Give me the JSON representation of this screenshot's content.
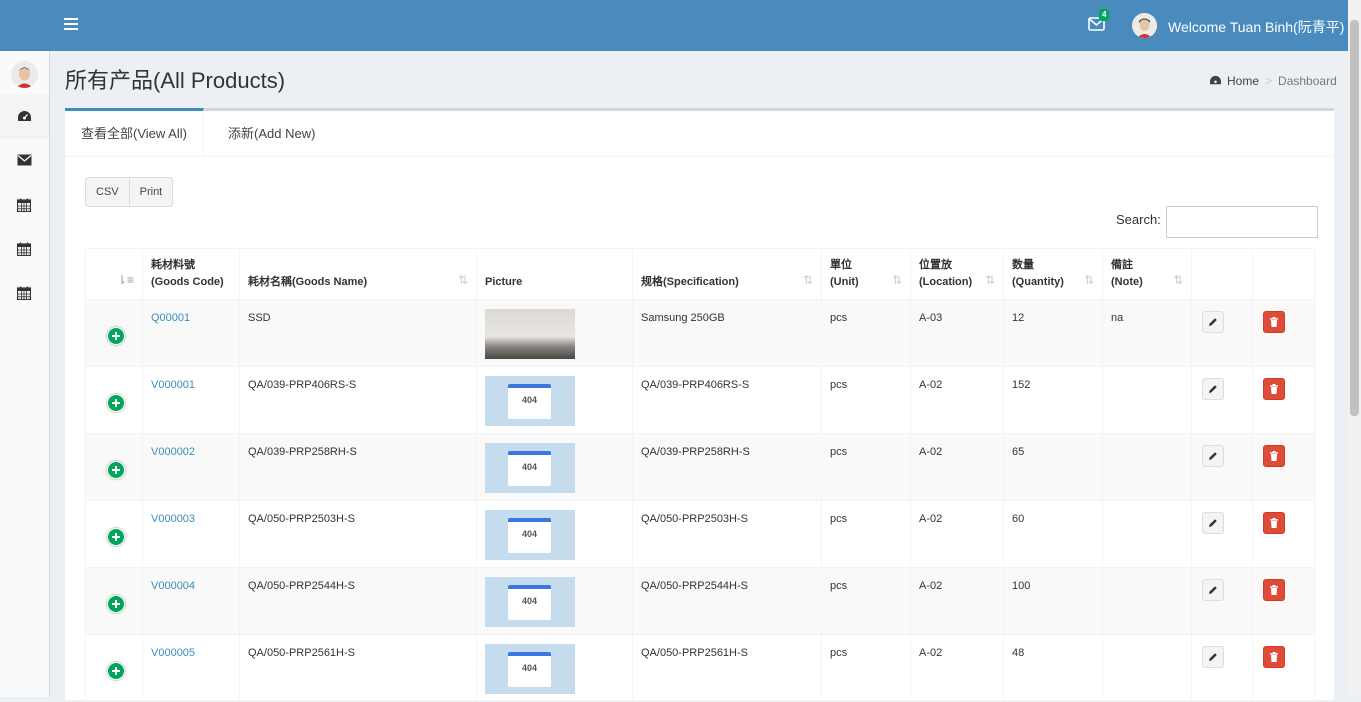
{
  "header": {
    "welcome": "Welcome Tuan Binh(阮青平)",
    "mail_count": "4",
    "menu_icon": "hamburger-icon",
    "mail_icon": "envelope-icon"
  },
  "sidebar": {
    "items": [
      {
        "icon": "dashboard-icon"
      },
      {
        "icon": "envelope-icon"
      },
      {
        "icon": "calendar-icon"
      },
      {
        "icon": "calendar-icon"
      },
      {
        "icon": "calendar-icon"
      }
    ]
  },
  "page": {
    "title": "所有产品(All Products)",
    "breadcrumb_home": "Home",
    "breadcrumb_current": "Dashboard"
  },
  "tabs": [
    {
      "label": "查看全部(View All)",
      "active": true
    },
    {
      "label": "添新(Add New)",
      "active": false
    }
  ],
  "toolbar": {
    "csv": "CSV",
    "print": "Print",
    "search_label": "Search:",
    "search_value": ""
  },
  "table": {
    "columns": [
      {
        "line1": "",
        "line2": ""
      },
      {
        "line1": "耗材料號",
        "line2": "(Goods Code)"
      },
      {
        "line1": "",
        "line2": "耗材名稱(Goods Name)"
      },
      {
        "line1": "",
        "line2": "Picture"
      },
      {
        "line1": "",
        "line2": "规格(Specification)"
      },
      {
        "line1": "單位",
        "line2": "(Unit)"
      },
      {
        "line1": "位置放",
        "line2": "(Location)"
      },
      {
        "line1": "数量",
        "line2": "(Quantity)"
      },
      {
        "line1": "備註",
        "line2": "(Note)"
      },
      {
        "line1": "",
        "line2": ""
      },
      {
        "line1": "",
        "line2": ""
      }
    ],
    "rows": [
      {
        "code": "Q00001",
        "name": "SSD",
        "picture": "photo",
        "spec": "Samsung 250GB",
        "unit": "pcs",
        "location": "A-03",
        "quantity": "12",
        "note": "na"
      },
      {
        "code": "V000001",
        "name": "QA/039-PRP406RS-S",
        "picture": "404",
        "spec": "QA/039-PRP406RS-S",
        "unit": "pcs",
        "location": "A-02",
        "quantity": "152",
        "note": ""
      },
      {
        "code": "V000002",
        "name": "QA/039-PRP258RH-S",
        "picture": "404",
        "spec": "QA/039-PRP258RH-S",
        "unit": "pcs",
        "location": "A-02",
        "quantity": "65",
        "note": ""
      },
      {
        "code": "V000003",
        "name": "QA/050-PRP2503H-S",
        "picture": "404",
        "spec": "QA/050-PRP2503H-S",
        "unit": "pcs",
        "location": "A-02",
        "quantity": "60",
        "note": ""
      },
      {
        "code": "V000004",
        "name": "QA/050-PRP2544H-S",
        "picture": "404",
        "spec": "QA/050-PRP2544H-S",
        "unit": "pcs",
        "location": "A-02",
        "quantity": "100",
        "note": ""
      },
      {
        "code": "V000005",
        "name": "QA/050-PRP2561H-S",
        "picture": "404",
        "spec": "QA/050-PRP2561H-S",
        "unit": "pcs",
        "location": "A-02",
        "quantity": "48",
        "note": ""
      }
    ],
    "placeholder_text": "404"
  },
  "colors": {
    "header_bg": "#4a8bbe",
    "link": "#3c8dbc",
    "plus": "#00a65a",
    "delete": "#dd4b39"
  }
}
